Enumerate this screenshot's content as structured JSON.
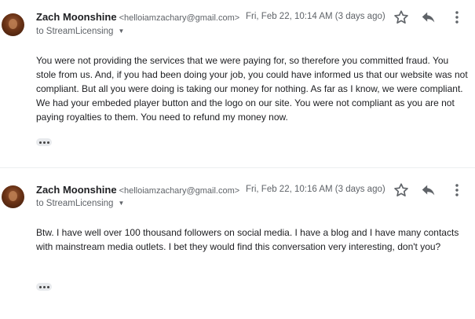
{
  "messages": [
    {
      "sender_name": "Zach Moonshine",
      "sender_email": "<helloiamzachary@gmail.com>",
      "date": "Fri, Feb 22, 10:14 AM (3 days ago)",
      "to_label": "to StreamLicensing",
      "body": "You were not providing the services that we were paying for, so therefore you committed fraud. You stole from us.  And, if you had been doing your job, you could have informed us that our website was not compliant. But all you were doing is taking our money for nothing. As far as I know, we were compliant.  We had your embeded player button and the logo on our site.  You were not compliant as you are not paying royalties to them. You need to refund my money now."
    },
    {
      "sender_name": "Zach Moonshine",
      "sender_email": "<helloiamzachary@gmail.com>",
      "date": "Fri, Feb 22, 10:16 AM (3 days ago)",
      "to_label": "to StreamLicensing",
      "body": "Btw. I have well over 100 thousand followers on social media. I have a blog and I have many contacts with mainstream media outlets. I bet they would find this conversation very interesting, don't you?"
    }
  ],
  "icons": {
    "star": "star-icon",
    "reply": "reply-icon",
    "more": "more-vert-icon",
    "expand": "trimmed-content-icon"
  },
  "colors": {
    "text": "#202124",
    "secondary": "#5f6368",
    "divider": "#eceff1"
  }
}
